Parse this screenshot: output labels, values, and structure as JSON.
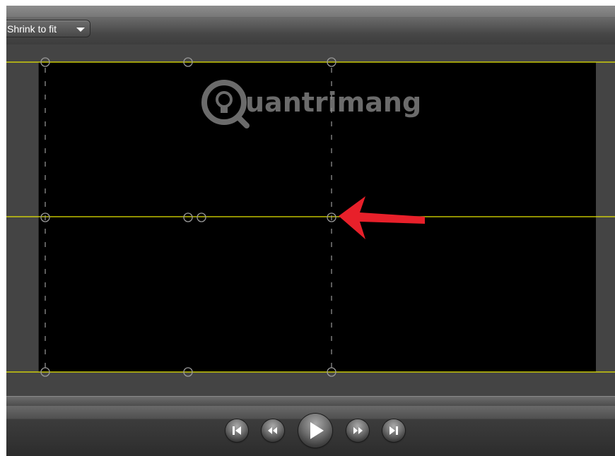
{
  "toolbar": {
    "zoom_selector": {
      "value": "Shrink to fit",
      "arrow_icon": "chevron-down-icon"
    }
  },
  "watermark": {
    "text": "uantrimang",
    "logo_icon": "lightbulb-logo"
  },
  "canvas": {
    "guides_color": "#e6e600",
    "handle_color": "#9a9a9a",
    "annotation": {
      "type": "arrow",
      "color": "#e8202a",
      "icon": "red-arrow-icon"
    }
  },
  "playback_controls": [
    {
      "name": "skip-to-start-button",
      "icon": "skip-back-icon"
    },
    {
      "name": "rewind-button",
      "icon": "rewind-icon"
    },
    {
      "name": "play-button",
      "icon": "play-icon"
    },
    {
      "name": "fast-forward-button",
      "icon": "fast-forward-icon"
    },
    {
      "name": "skip-to-end-button",
      "icon": "skip-forward-icon"
    }
  ]
}
